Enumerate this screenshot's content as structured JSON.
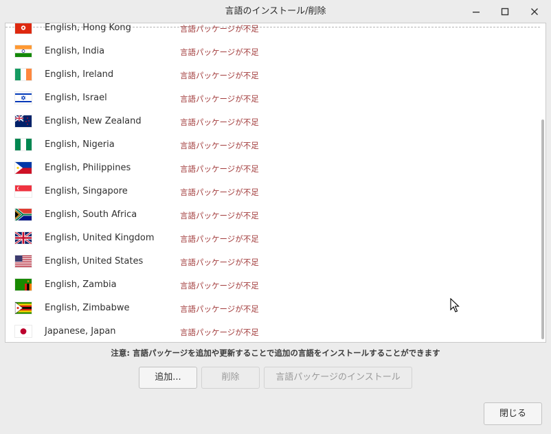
{
  "window": {
    "title": "言語のインストール/削除",
    "controls": [
      "minimize-icon",
      "maximize-icon",
      "close-icon"
    ]
  },
  "languages": [
    {
      "name": "English, Hong Kong",
      "status": "言語パッケージが不足",
      "flag": "hk"
    },
    {
      "name": "English, India",
      "status": "言語パッケージが不足",
      "flag": "in"
    },
    {
      "name": "English, Ireland",
      "status": "言語パッケージが不足",
      "flag": "ie"
    },
    {
      "name": "English, Israel",
      "status": "言語パッケージが不足",
      "flag": "il"
    },
    {
      "name": "English, New Zealand",
      "status": "言語パッケージが不足",
      "flag": "nz"
    },
    {
      "name": "English, Nigeria",
      "status": "言語パッケージが不足",
      "flag": "ng"
    },
    {
      "name": "English, Philippines",
      "status": "言語パッケージが不足",
      "flag": "ph"
    },
    {
      "name": "English, Singapore",
      "status": "言語パッケージが不足",
      "flag": "sg"
    },
    {
      "name": "English, South Africa",
      "status": "言語パッケージが不足",
      "flag": "za"
    },
    {
      "name": "English, United Kingdom",
      "status": "言語パッケージが不足",
      "flag": "gb"
    },
    {
      "name": "English, United States",
      "status": "言語パッケージが不足",
      "flag": "us"
    },
    {
      "name": "English, Zambia",
      "status": "言語パッケージが不足",
      "flag": "zm"
    },
    {
      "name": "English, Zimbabwe",
      "status": "言語パッケージが不足",
      "flag": "zw"
    },
    {
      "name": "Japanese, Japan",
      "status": "言語パッケージが不足",
      "flag": "jp"
    }
  ],
  "note": "注意: 言語パッケージを追加や更新することで追加の言語をインストールすることができます",
  "buttons": {
    "add": "追加...",
    "remove": "削除",
    "install": "言語パッケージのインストール",
    "close": "閉じる"
  },
  "colors": {
    "status_text": "#a23c3c",
    "window_bg": "#ececec"
  }
}
